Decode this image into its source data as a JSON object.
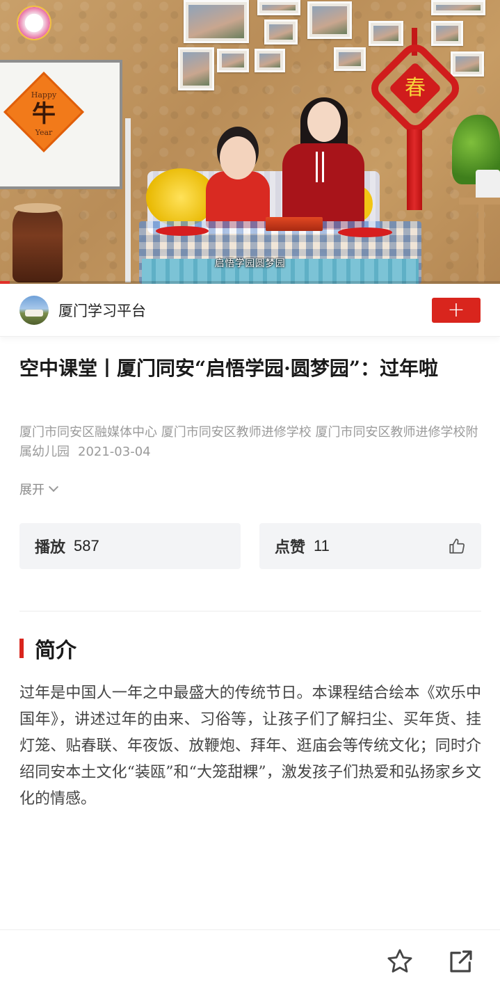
{
  "video": {
    "caption": "启悟学园圆梦园",
    "board_top": "Happy",
    "board_char": "牛",
    "board_bottom": "Year",
    "knot_char": "春",
    "progress_fraction": 0.02
  },
  "publisher": {
    "name": "厦门学习平台",
    "follow_label": "+"
  },
  "article": {
    "title": "空中课堂丨厦门同安“启悟学园·圆梦园”：过年啦",
    "authors": "厦门市同安区融媒体中心 厦门市同安区教师进修学校 厦门市同安区教师进修学校附属幼儿园",
    "date": "2021-03-04",
    "expand_label": "展开"
  },
  "stats": {
    "play_label": "播放",
    "play_count": "587",
    "like_label": "点赞",
    "like_count": "11"
  },
  "intro": {
    "heading": "简介",
    "body": "过年是中国人一年之中最盛大的传统节日。本课程结合绘本《欢乐中国年》，讲述过年的由来、习俗等，让孩子们了解扫尘、买年货、挂灯笼、贴春联、年夜饭、放鞭炮、拜年、逛庙会等传统文化；同时介绍同安本土文化“装瓯”和“大笼甜粿”，激发孩子们热爱和弘扬家乡文化的情感。"
  },
  "colors": {
    "accent": "#d9251d",
    "muted_text": "#9a9a9a",
    "stat_bg": "#f3f4f6"
  },
  "icons": {
    "like": "thumbs-up-icon",
    "favorite": "star-icon",
    "share": "share-icon",
    "expand": "chevron-down-icon"
  }
}
